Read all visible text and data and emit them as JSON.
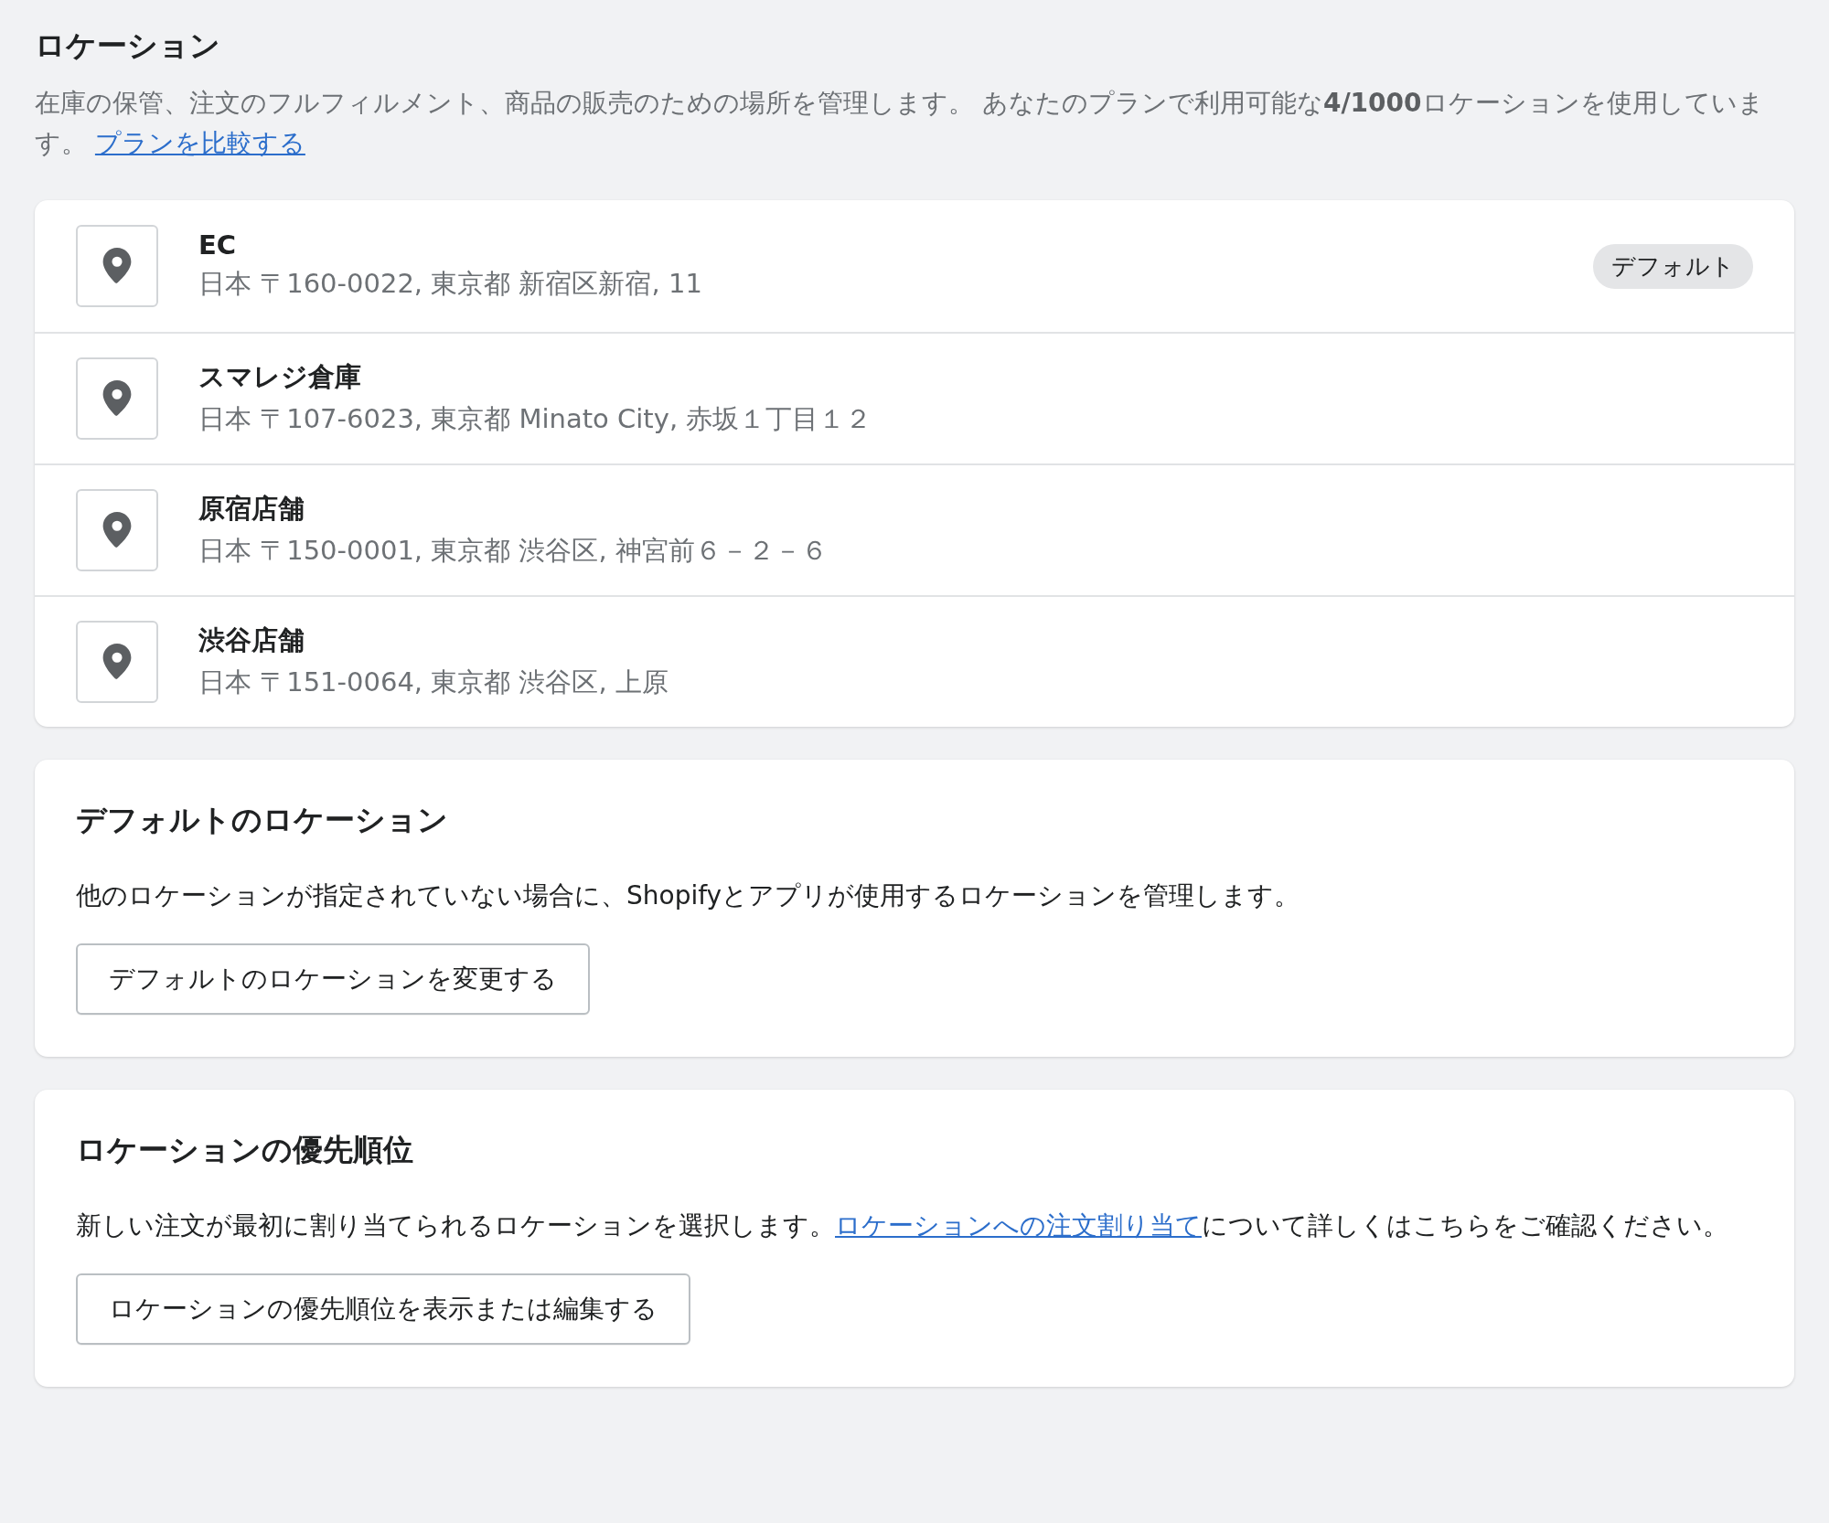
{
  "header": {
    "title": "ロケーション",
    "description": "在庫の保管、注文のフルフィルメント、商品の販売のための場所を管理します。 あなたのプランで利用可能な**4/1000**ロケーションを使用しています。",
    "link": "プランを比較する"
  },
  "locations": [
    {
      "name": "EC",
      "address": "日本 〒160-0022, 東京都 新宿区新宿, 11",
      "badge": "デフォルト"
    },
    {
      "name": "スマレジ倉庫",
      "address": "日本 〒107-6023, 東京都 Minato City, 赤坂１丁目１２"
    },
    {
      "name": "原宿店舗",
      "address": "日本 〒150-0001, 東京都 渋谷区, 神宮前６－２－６"
    },
    {
      "name": "渋谷店舗",
      "address": "日本 〒151-0064, 東京都 渋谷区, 上原"
    }
  ],
  "default_section": {
    "title": "デフォルトのロケーション",
    "description": "他のロケーションが指定されていない場合に、Shopifyとアプリが使用するロケーションを管理します。",
    "button": "デフォルトのロケーションを変更する"
  },
  "priority_section": {
    "title": "ロケーションの優先順位",
    "description_before": "新しい注文が最初に割り当てられるロケーションを選択します。",
    "link": "ロケーションへの注文割り当て",
    "description_after": "について詳しくはこちらをご確認ください。",
    "button": "ロケーションの優先順位を表示または編集する"
  }
}
